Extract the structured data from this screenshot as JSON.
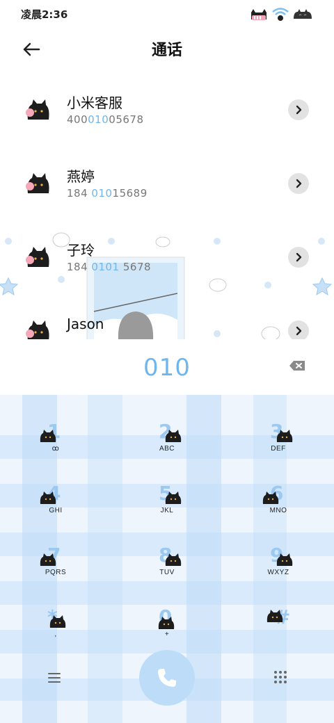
{
  "status_bar": {
    "time": "凌晨2:36"
  },
  "header": {
    "title": "通话"
  },
  "contacts": [
    {
      "name": "小米客服",
      "number_pre": "400",
      "number_hl": "010",
      "number_post": "05678"
    },
    {
      "name": "燕婷",
      "number_pre": "184 ",
      "number_hl": "010",
      "number_post": "15689"
    },
    {
      "name": "子玲",
      "number_pre": "184 ",
      "number_hl": "0101",
      "number_post": " 5678"
    },
    {
      "name": "Jason",
      "number_pre": "",
      "number_hl": "",
      "number_post": ""
    }
  ],
  "dialer": {
    "digits": "010"
  },
  "keys": [
    {
      "digit": "1",
      "letters": "ꝏ"
    },
    {
      "digit": "2",
      "letters": "ABC"
    },
    {
      "digit": "3",
      "letters": "DEF"
    },
    {
      "digit": "4",
      "letters": "GHI"
    },
    {
      "digit": "5",
      "letters": "JKL"
    },
    {
      "digit": "6",
      "letters": "MNO"
    },
    {
      "digit": "7",
      "letters": "PQRS"
    },
    {
      "digit": "8",
      "letters": "TUV"
    },
    {
      "digit": "9",
      "letters": "WXYZ"
    },
    {
      "digit": "*",
      "letters": ","
    },
    {
      "digit": "0",
      "letters": "+"
    },
    {
      "digit": "#",
      "letters": ""
    }
  ],
  "colors": {
    "accent": "#6fb6ec",
    "call_button": "#bcdcf7",
    "keypad_bg": "#eef5fd"
  },
  "icons": {
    "back": "arrow-left-icon",
    "detail": "chevron-right-icon",
    "backspace": "backspace-icon",
    "menu": "menu-icon",
    "call": "phone-icon",
    "dialpad": "dialpad-icon",
    "avatar": "black-cat-avatar"
  }
}
